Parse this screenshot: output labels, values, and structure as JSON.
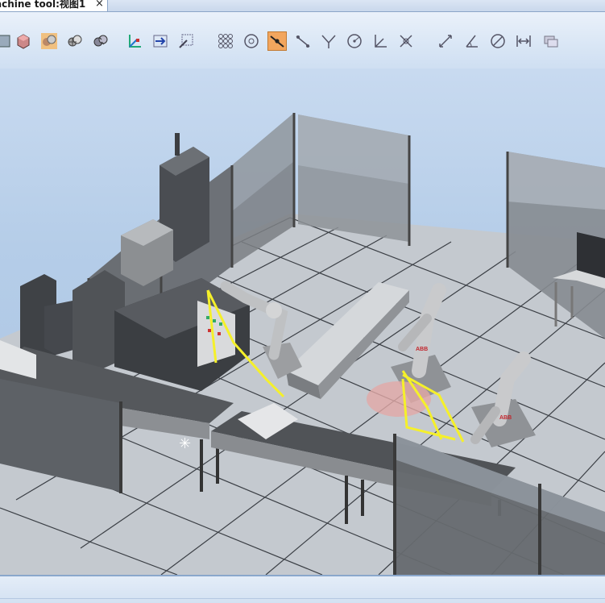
{
  "tab": {
    "title": "achine  tool:视图1",
    "close_glyph": "×"
  },
  "toolbar": {
    "groups": [
      {
        "name": "view-modes",
        "icons": [
          "view-wireframe-icon",
          "solid-box-icon",
          "shaded-spheres-icon",
          "mesh-spheres-icon",
          "checker-spheres-icon"
        ]
      },
      {
        "name": "frames",
        "icons": [
          "frame-axes-icon",
          "move-arrow-icon",
          "scale-icon"
        ]
      },
      {
        "name": "selection",
        "icons": [
          "grid-select-icon",
          "circle-target-icon",
          "snap-edge-icon",
          "snap-midpoint-icon",
          "snap-intersection-icon",
          "snap-center-icon",
          "snap-angle-icon",
          "snap-cross-icon"
        ]
      },
      {
        "name": "measure",
        "icons": [
          "measure-distance-icon",
          "measure-angle-icon",
          "measure-diameter-icon",
          "measure-minimum-icon",
          "stack-layers-icon"
        ]
      }
    ],
    "active_icon": "snap-edge-icon"
  },
  "scene": {
    "description_visible_text": [
      "ABB"
    ],
    "robot_logo": "ABB"
  },
  "colors": {
    "accent_active": "#f2a65e",
    "path_yellow": "#f5f02a",
    "tab_border": "#8ca6c8"
  }
}
